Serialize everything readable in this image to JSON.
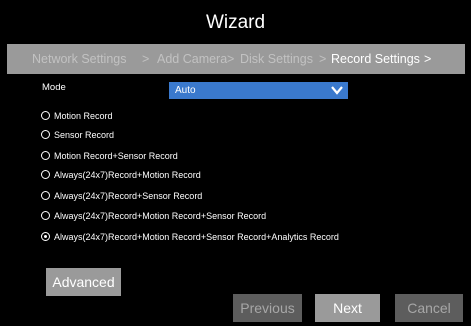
{
  "window": {
    "title": "Wizard"
  },
  "breadcrumb": {
    "steps": [
      "Network Settings",
      "Add Camera",
      "Disk Settings",
      "Record Settings"
    ],
    "separator": ">",
    "active_index": 3
  },
  "mode": {
    "label": "Mode",
    "selected": "Auto",
    "icon": "chevron-down-icon"
  },
  "options": [
    {
      "label": "Motion Record",
      "selected": false
    },
    {
      "label": "Sensor Record",
      "selected": false
    },
    {
      "label": "Motion Record+Sensor Record",
      "selected": false
    },
    {
      "label": "Always(24x7)Record+Motion Record",
      "selected": false
    },
    {
      "label": "Always(24x7)Record+Sensor Record",
      "selected": false
    },
    {
      "label": "Always(24x7)Record+Motion Record+Sensor Record",
      "selected": false
    },
    {
      "label": "Always(24x7)Record+Motion  Record+Sensor Record+Analytics  Record",
      "selected": true
    }
  ],
  "buttons": {
    "advanced": "Advanced",
    "previous": "Previous",
    "next": "Next",
    "cancel": "Cancel"
  },
  "colors": {
    "background": "#000000",
    "bar": "#9a9a9a",
    "select_blue": "#3a79cd",
    "disabled_button": "#5d5d5d"
  }
}
